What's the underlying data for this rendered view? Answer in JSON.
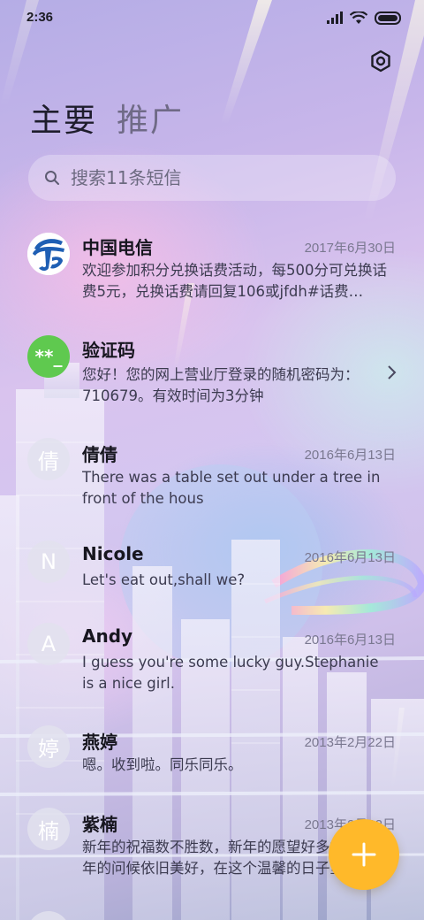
{
  "status_bar": {
    "time": "2:36"
  },
  "tabs": [
    {
      "label": "主要",
      "active": true
    },
    {
      "label": "推广",
      "active": false
    }
  ],
  "search": {
    "placeholder": "搜索11条短信",
    "value": ""
  },
  "conversations": [
    {
      "sender": "中国电信",
      "date": "2017年6月30日",
      "preview": "欢迎参加积分兑换话费活动，每500分可兑换话费5元，兑换话费请回复106或jfdh#话费…",
      "avatar": "china-telecom-logo"
    },
    {
      "sender": "验证码",
      "date": "",
      "preview": "您好！您的网上营业厅登录的随机密码为：710679。有效时间为3分钟",
      "avatar_text": "**_",
      "avatar_color": "#5fc94f"
    },
    {
      "sender": "倩倩",
      "date": "2016年6月13日",
      "preview": "There was a table set out under a tree in front of the hous",
      "avatar_text": "倩"
    },
    {
      "sender": "Nicole",
      "date": "2016年6月13日",
      "preview": "Let's eat out,shall we?",
      "avatar_text": "N"
    },
    {
      "sender": "Andy",
      "date": "2016年6月13日",
      "preview": "I guess you're some lucky guy.Stephanie is a nice girl.",
      "avatar_text": "A"
    },
    {
      "sender": "燕婷",
      "date": "2013年2月22日",
      "preview": "嗯。收到啦。同乐同乐。",
      "avatar_text": "婷"
    },
    {
      "sender": "紫楠",
      "date": "2013年2月22日",
      "preview": "新年的祝福数不胜数，新年的愿望好多好多，新年的问候依旧美好，在这个温馨的日子里",
      "avatar_text": "楠"
    }
  ],
  "colors": {
    "fab": "#ffb92a",
    "verification_avatar": "#5fc94f",
    "telecom_blue": "#1f5fb4"
  },
  "icons": [
    "settings-icon",
    "search-icon",
    "chevron-right-icon",
    "plus-icon",
    "signal-icon",
    "wifi-icon",
    "battery-icon"
  ]
}
